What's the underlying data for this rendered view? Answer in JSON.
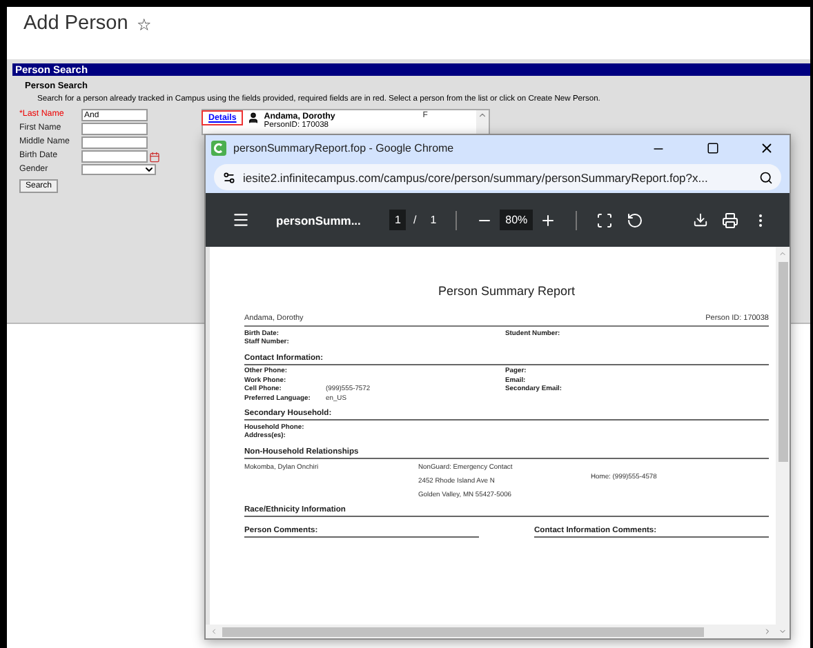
{
  "page": {
    "title": "Add Person",
    "favorite_icon": "☆"
  },
  "panel": {
    "header": "Person Search",
    "section_title": "Person Search",
    "instructions": "Search for a person already tracked in Campus using the fields provided, required fields are in red. Select a person from the list or click on Create New Person."
  },
  "form": {
    "fields": [
      {
        "label": "*Last Name",
        "required": true,
        "kind": "text",
        "value": "And"
      },
      {
        "label": "First Name",
        "required": false,
        "kind": "text"
      },
      {
        "label": "Middle Name",
        "required": false,
        "kind": "text"
      },
      {
        "label": "Birth Date",
        "required": false,
        "kind": "date"
      },
      {
        "label": "Gender",
        "required": false,
        "kind": "select"
      }
    ],
    "button": "Search"
  },
  "results": [
    {
      "link": "Details",
      "highlighted": true,
      "name": "Andama, Dorothy",
      "person_id": "PersonID: 170038",
      "gender": "F"
    }
  ],
  "popup": {
    "title": "personSummaryReport.fop - Google Chrome",
    "url": "iesite2.infinitecampus.com/campus/core/person/summary/personSummaryReport.fop?x...",
    "pdf_toolbar": {
      "filename": "personSumm...",
      "page": "1",
      "page_separator": "/",
      "page_total": "1",
      "zoom": "80%"
    },
    "report": {
      "title": "Person Summary Report",
      "name": "Andama, Dorothy",
      "person_id": "Person ID: 170038",
      "sections": [
        {
          "kind": "fields",
          "left": [
            {
              "label": "Birth Date:"
            },
            {
              "label": "Staff Number:"
            }
          ],
          "right": [
            {
              "label": "Student Number:"
            }
          ]
        },
        {
          "kind": "fields",
          "heading": "Contact Information:",
          "left": [
            {
              "label": "Other Phone:"
            },
            {
              "label": "Work Phone:"
            },
            {
              "label": "Cell Phone:",
              "value": "(999)555-7572"
            },
            {
              "label": "Preferred Language:",
              "value": "en_US"
            }
          ],
          "right": [
            {
              "label": "Pager:"
            },
            {
              "label": "Email:"
            },
            {
              "label": "Secondary Email:"
            }
          ]
        },
        {
          "kind": "fields",
          "heading": "Secondary Household:",
          "left": [
            {
              "label": "Household Phone:"
            },
            {
              "label": "Address(es):"
            }
          ]
        },
        {
          "kind": "relationships",
          "heading": "Non-Household Relationships",
          "items": [
            {
              "name": "Mokomba, Dylan Onchiri",
              "details": [
                "NonGuard: Emergency Contact",
                "2452 Rhode Island Ave N",
                "Golden Valley, MN 55427-5006"
              ],
              "phone": "Home: (999)555-4578"
            }
          ]
        },
        {
          "kind": "heading",
          "heading": "Race/Ethnicity Information"
        },
        {
          "kind": "comments",
          "items": [
            "Person Comments:",
            "Contact Information Comments:"
          ]
        }
      ]
    }
  }
}
